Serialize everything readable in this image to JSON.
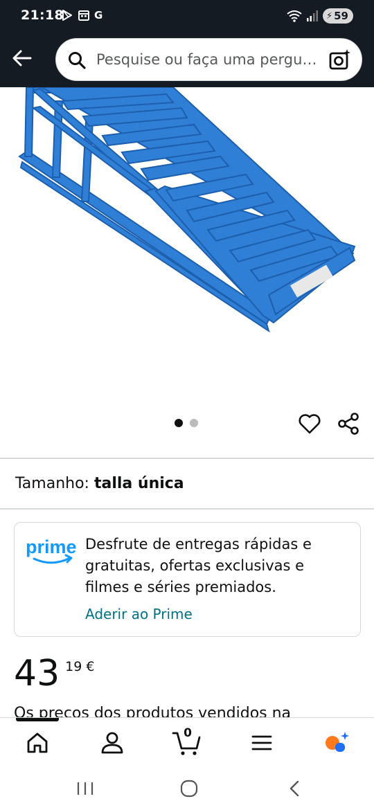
{
  "status_bar": {
    "time": "21:18",
    "left_icons": [
      "play-store-icon",
      "calendar-icon",
      "google-icon"
    ],
    "google_letter": "G",
    "battery": "59"
  },
  "header": {
    "search_placeholder": "Pesquise ou faça uma pergunta",
    "icons": [
      "back-arrow-icon",
      "search-icon",
      "camera-search-icon"
    ]
  },
  "product": {
    "image_alt": "blue steel car ramp",
    "image_count": 2,
    "active_image": 1,
    "size_label": "Tamanho:",
    "size_value": "talla única",
    "price_whole": "43",
    "price_fraction": "19 €",
    "price_note": "Os preços dos produtos vendidos na"
  },
  "prime": {
    "logo_text": "prime",
    "description": "Desfrute de entregas rápidas e gratuitas, ofertas exclusivas e filmes e séries premiados.",
    "link": "Aderir ao Prime"
  },
  "bottom_nav": {
    "items": [
      "home",
      "account",
      "cart",
      "menu",
      "rufus"
    ],
    "cart_count": "0",
    "active": "home"
  },
  "colors": {
    "header_bg": "#141b23",
    "link": "#007185",
    "prime_blue": "#1399ff",
    "ramp_blue": "#2f7fd6",
    "rufus_orange": "#ff7a1a",
    "rufus_blue": "#1f6fff"
  }
}
